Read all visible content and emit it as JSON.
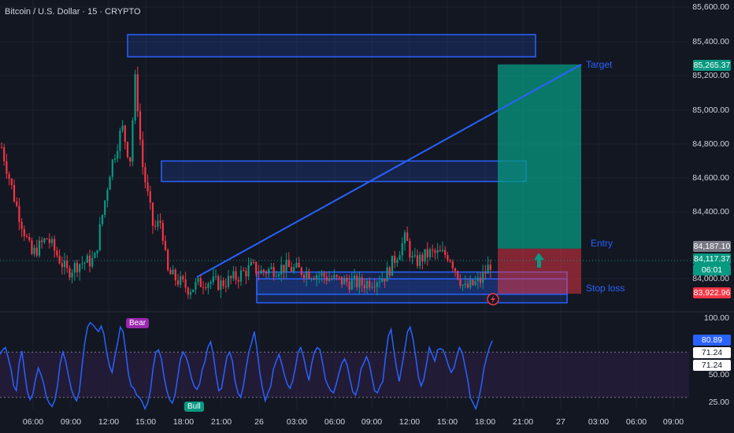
{
  "symbol_title": "Bitcoin / U.S. Dollar · 15 · CRYPTO",
  "colors": {
    "bg": "#131722",
    "up": "#089981",
    "down": "#f23645",
    "zone": "#2962ff",
    "target": "#089981",
    "stop": "#f23645",
    "rsi_line": "#2962ff",
    "rsi_band": "#2a1e3f"
  },
  "price_axis": {
    "ticks": [
      "85,600.00",
      "85,400.00",
      "85,200.00",
      "85,000.00",
      "84,800.00",
      "84,600.00",
      "84,400.00",
      "84,000.00"
    ]
  },
  "rsi_axis": {
    "ticks": [
      "100.00",
      "50.00",
      "25.00"
    ]
  },
  "badges": {
    "target": "85,265.37",
    "entry": "84,187.10",
    "last_price": "84,117.37",
    "countdown": "06:01",
    "stop": "83,922.96",
    "rsi_value": "80.89",
    "rsi_a": "71.24",
    "rsi_b": "71.24"
  },
  "annotations": {
    "target": "Target",
    "entry": "Entry",
    "stop": "Stop loss",
    "bear": "Bear",
    "bull": "Bull"
  },
  "x_axis": [
    {
      "label": "06:00",
      "x": 42
    },
    {
      "label": "09:00",
      "x": 90
    },
    {
      "label": "12:00",
      "x": 138
    },
    {
      "label": "15:00",
      "x": 185
    },
    {
      "label": "18:00",
      "x": 233
    },
    {
      "label": "21:00",
      "x": 281
    },
    {
      "label": "26",
      "x": 329
    },
    {
      "label": "03:00",
      "x": 377
    },
    {
      "label": "06:00",
      "x": 425
    },
    {
      "label": "09:00",
      "x": 472
    },
    {
      "label": "12:00",
      "x": 520
    },
    {
      "label": "15:00",
      "x": 568
    },
    {
      "label": "18:00",
      "x": 616
    },
    {
      "label": "21:00",
      "x": 664
    },
    {
      "label": "27",
      "x": 712
    },
    {
      "label": "03:00",
      "x": 760
    },
    {
      "label": "06:00",
      "x": 808
    },
    {
      "label": "09:00",
      "x": 855
    }
  ],
  "chart_data": {
    "type": "candlestick",
    "symbol": "Bitcoin / U.S. Dollar",
    "interval": "15",
    "exchange": "CRYPTO",
    "y_range": [
      83850,
      85650
    ],
    "overlay": {
      "target": 85265.37,
      "entry": 84187.1,
      "stop": 83922.96,
      "last_price": 84117.37
    },
    "zones": [
      {
        "top": 85440,
        "bottom": 85310
      },
      {
        "top": 84700,
        "bottom": 84580
      },
      {
        "top": 84050,
        "bottom": 83920
      },
      {
        "top": 84010,
        "bottom": 83870
      }
    ],
    "rsi": {
      "range": [
        15,
        100
      ],
      "value": 80.89,
      "signal": 71.24,
      "levels": [
        70,
        30
      ],
      "values": [
        68,
        72,
        74,
        65,
        55,
        40,
        36,
        60,
        71,
        52,
        35,
        28,
        33,
        46,
        56,
        50,
        42,
        30,
        25,
        22,
        27,
        40,
        60,
        70,
        62,
        50,
        38,
        31,
        27,
        35,
        58,
        78,
        92,
        96,
        94,
        91,
        88,
        93,
        86,
        70,
        58,
        52,
        66,
        78,
        92,
        88,
        70,
        50,
        40,
        38,
        32,
        30,
        26,
        20,
        25,
        36,
        56,
        70,
        72,
        64,
        48,
        36,
        28,
        25,
        32,
        48,
        64,
        70,
        66,
        58,
        47,
        40,
        37,
        42,
        55,
        62,
        74,
        79,
        68,
        50,
        36,
        38,
        52,
        66,
        70,
        62,
        44,
        34,
        30,
        40,
        56,
        70,
        78,
        88,
        72,
        52,
        38,
        27,
        34,
        40,
        55,
        62,
        68,
        60,
        50,
        42,
        38,
        44,
        56,
        70,
        74,
        66,
        54,
        45,
        60,
        70,
        74,
        72,
        60,
        46,
        40,
        36,
        34,
        42,
        52,
        60,
        64,
        58,
        46,
        35,
        32,
        40,
        55,
        60,
        66,
        60,
        48,
        36,
        34,
        40,
        44,
        66,
        84,
        90,
        72,
        56,
        44,
        58,
        72,
        88,
        92,
        82,
        66,
        48,
        40,
        46,
        60,
        74,
        68,
        62,
        72,
        73,
        72,
        66,
        58,
        52,
        56,
        66,
        74,
        70,
        58,
        46,
        30,
        25,
        20,
        28,
        40,
        56,
        66,
        74,
        80
      ]
    }
  }
}
